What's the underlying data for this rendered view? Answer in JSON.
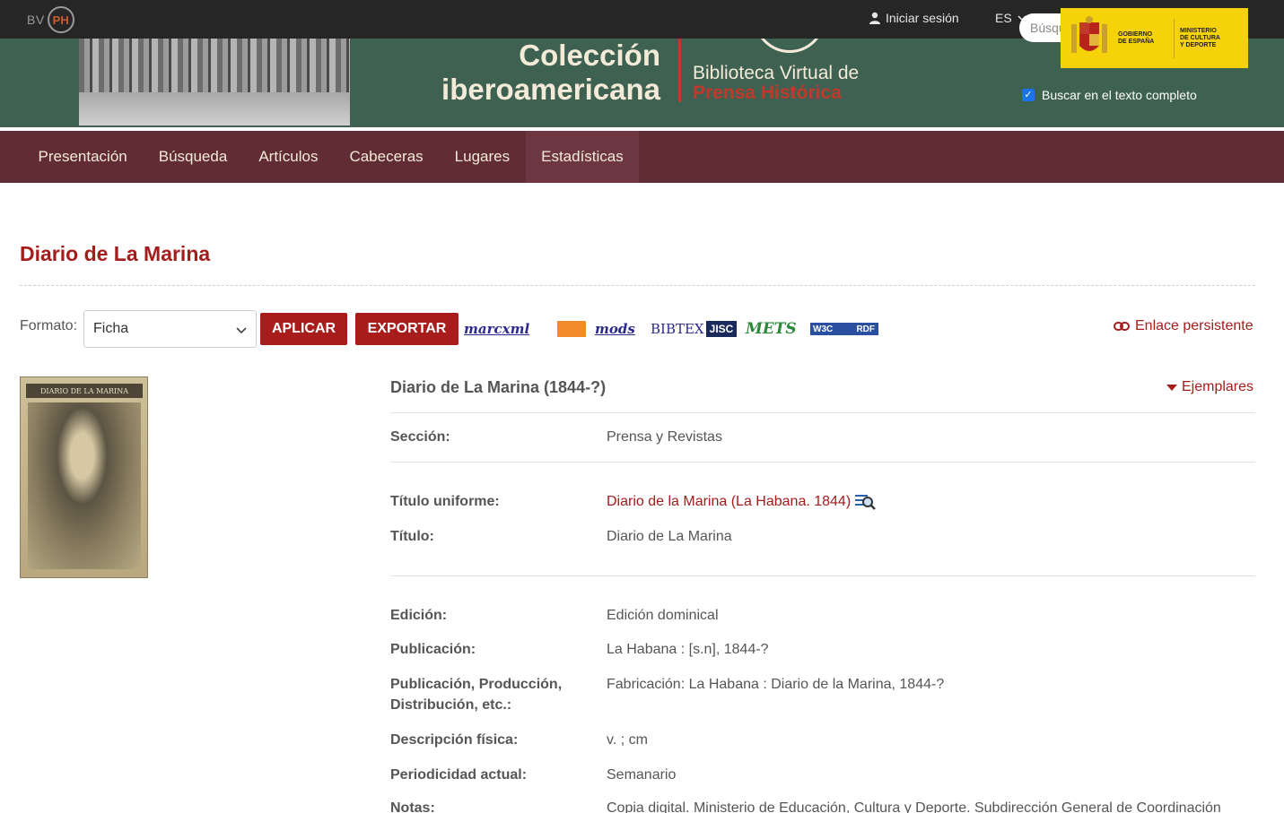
{
  "topbar": {
    "logo_bv": "BV",
    "logo_ph": "PH",
    "login_label": "Iniciar sesión",
    "lang_label": "ES"
  },
  "banner": {
    "collection_line1": "Colección",
    "collection_line2": "iberoamericana",
    "site_line1": "Biblioteca Virtual de",
    "site_line2": "Prensa Histórica",
    "search_placeholder": "Búsqueda",
    "fulltext_label": "Buscar en el texto completo",
    "fulltext_checked": true,
    "gov_line1": "GOBIERNO",
    "gov_line2": "DE ESPAÑA",
    "ministry_line1": "MINISTERIO",
    "ministry_line2": "DE CULTURA",
    "ministry_line3": "Y DEPORTE"
  },
  "nav": {
    "items": [
      {
        "label": "Presentación",
        "active": false
      },
      {
        "label": "Búsqueda",
        "active": false
      },
      {
        "label": "Artículos",
        "active": false
      },
      {
        "label": "Cabeceras",
        "active": false
      },
      {
        "label": "Lugares",
        "active": false
      },
      {
        "label": "Estadísticas",
        "active": true
      }
    ]
  },
  "page": {
    "title": "Diario de La Marina",
    "format_label": "Formato:",
    "format_selected": "Ficha",
    "apply_label": "APLICAR",
    "export_label": "EXPORTAR",
    "formats": {
      "marcxml": "marcxml",
      "mods": "mods",
      "bibtex": "BIBTEX",
      "jisc": "JISC",
      "mets": "METS",
      "w3c": "W3C",
      "rdf": "RDF"
    },
    "permalink_label": "Enlace persistente",
    "cover_masthead": "DIARIO DE LA MARINA"
  },
  "record": {
    "title": "Diario de La Marina (1844-?)",
    "copies_label": "Ejemplares",
    "fields": {
      "seccion_label": "Sección:",
      "seccion_value": "Prensa y Revistas",
      "titulo_uniforme_label": "Título uniforme:",
      "titulo_uniforme_value": "Diario de la Marina (La Habana. 1844)",
      "titulo_label": "Título:",
      "titulo_value": "Diario de La Marina",
      "edicion_label": "Edición:",
      "edicion_value": "Edición dominical",
      "publicacion_label": "Publicación:",
      "publicacion_value": "La Habana : [s.n], 1844-?",
      "produccion_label_1": "Publicación, Producción,",
      "produccion_label_2": "Distribución, etc.:",
      "produccion_value": "Fabricación: La Habana : Diario de la Marina, 1844-?",
      "descripcion_label": "Descripción física:",
      "descripcion_value": "v. ; cm",
      "periodicidad_label": "Periodicidad actual:",
      "periodicidad_value": "Semanario",
      "notas_label": "Notas:",
      "notas_value": "Copia digital. Ministerio de Educación, Cultura y Deporte. Subdirección General de Coordinación"
    }
  },
  "colors": {
    "topbar_bg": "#262626",
    "banner_bg": "#3f6152",
    "nav_bg": "#622c35",
    "accent_red": "#a41c1c",
    "gov_yellow": "#f6d20a"
  }
}
